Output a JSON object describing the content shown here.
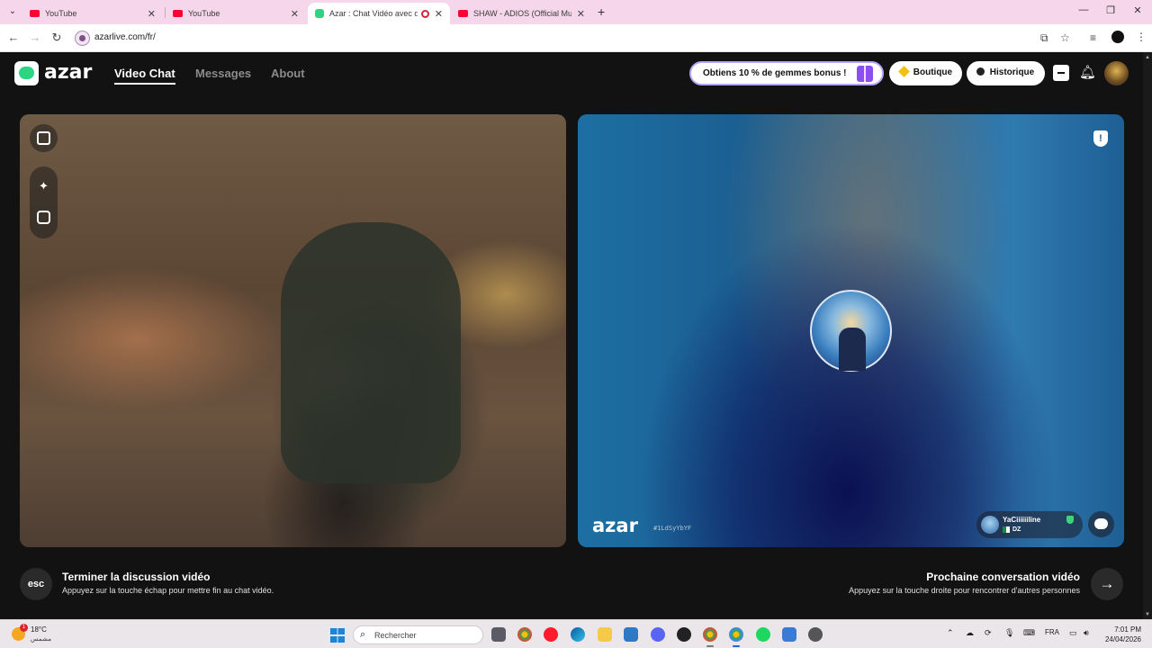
{
  "browser": {
    "tabs": [
      {
        "title": "YouTube",
        "favicon": "youtube-icon",
        "active": false
      },
      {
        "title": "YouTube",
        "favicon": "youtube-icon",
        "active": false
      },
      {
        "title": "Azar : Chat Vidéo avec de n",
        "favicon": "azar-icon",
        "active": true,
        "recording": true
      },
      {
        "title": "SHAW - ADIOS (Official Music V",
        "favicon": "youtube-icon",
        "active": false
      }
    ],
    "url": "azarlive.com/fr/"
  },
  "header": {
    "logo": "azar",
    "nav": [
      {
        "label": "Video Chat",
        "active": true
      },
      {
        "label": "Messages",
        "active": false
      },
      {
        "label": "About",
        "active": false
      }
    ],
    "promo_label": "Obtiens 10 % de gemmes bonus !",
    "shop_label": "Boutique",
    "history_label": "Historique"
  },
  "remote": {
    "watermark": "azar",
    "watermark_id": "#1LdSyYbYF",
    "username": "YaCiiiiiiline",
    "country": "DZ"
  },
  "controls": {
    "esc_key": "esc",
    "end_title": "Terminer la discussion vidéo",
    "end_hint": "Appuyez sur la touche échap pour mettre fin au chat vidéo.",
    "next_title": "Prochaine conversation vidéo",
    "next_hint": "Appuyez sur la touche droite pour rencontrer d'autres personnes"
  },
  "taskbar": {
    "weather_temp": "18°C",
    "weather_desc": "مشمس",
    "weather_badge": "1",
    "search_placeholder": "Rechercher",
    "language": "FRA",
    "time": "7:01 PM",
    "date": "24/04/2026"
  },
  "colors": {
    "accent_green": "#2dd583",
    "promo_border": "#b4a4f5",
    "tab_bar": "#f6d6ea"
  }
}
